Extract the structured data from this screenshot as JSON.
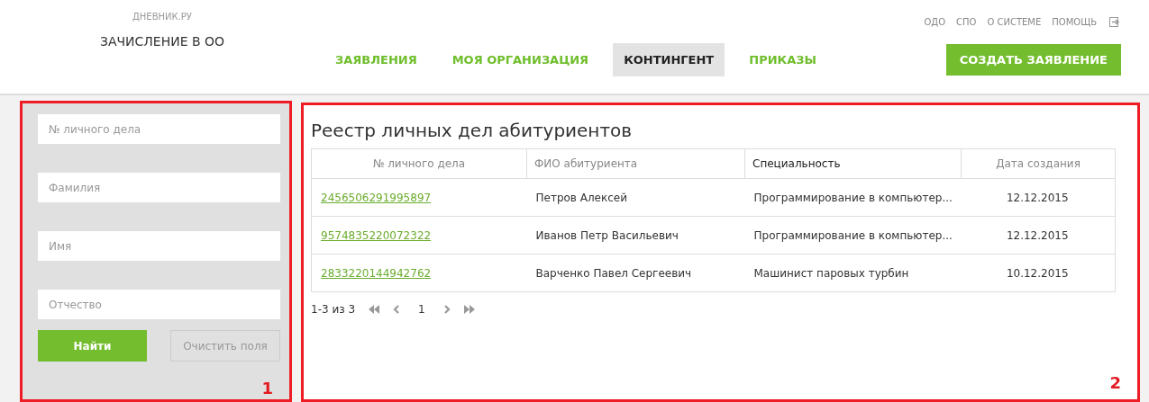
{
  "header": {
    "logo": "ДНЕВНИК.РУ",
    "title": "ЗАЧИСЛЕНИЕ В ОО",
    "top_links": [
      "ОДО",
      "СПО",
      "О СИСТЕМЕ",
      "ПОМОЩЬ"
    ],
    "nav": [
      {
        "label": "ЗАЯВЛЕНИЯ",
        "selected": false
      },
      {
        "label": "МОЯ ОРГАНИЗАЦИЯ",
        "selected": false
      },
      {
        "label": "КОНТИНГЕНТ",
        "selected": true
      },
      {
        "label": "ПРИКАЗЫ",
        "selected": false
      }
    ],
    "create_button": "СОЗДАТЬ ЗАЯВЛЕНИЕ"
  },
  "filter": {
    "fields": [
      {
        "placeholder": "№ личного дела"
      },
      {
        "placeholder": "Фамилия"
      },
      {
        "placeholder": "Имя"
      },
      {
        "placeholder": "Отчество"
      }
    ],
    "find_button": "Найти",
    "clear_button": "Очистить поля",
    "callout": "1"
  },
  "registry": {
    "title": "Реестр личных дел абитуриентов",
    "columns": [
      {
        "label": "№ личного дела",
        "sorted": false
      },
      {
        "label": "ФИО абитуриента",
        "sorted": false
      },
      {
        "label": "Специальность",
        "sorted": true
      },
      {
        "label": "Дата создания",
        "sorted": false
      }
    ],
    "rows": [
      {
        "number": "2456506291995897",
        "name": "Петров Алексей",
        "specialty": "Программирование в компьютер...",
        "date": "12.12.2015"
      },
      {
        "number": "9574835220072322",
        "name": "Иванов Петр Васильевич",
        "specialty": "Программирование в компьютер...",
        "date": "12.12.2015"
      },
      {
        "number": "2833220144942762",
        "name": "Варченко Павел Сергеевич",
        "specialty": "Машинист паровых турбин",
        "date": "10.12.2015"
      }
    ],
    "pagination": {
      "range": "1-3 из 3",
      "page": "1"
    },
    "callout": "2"
  }
}
